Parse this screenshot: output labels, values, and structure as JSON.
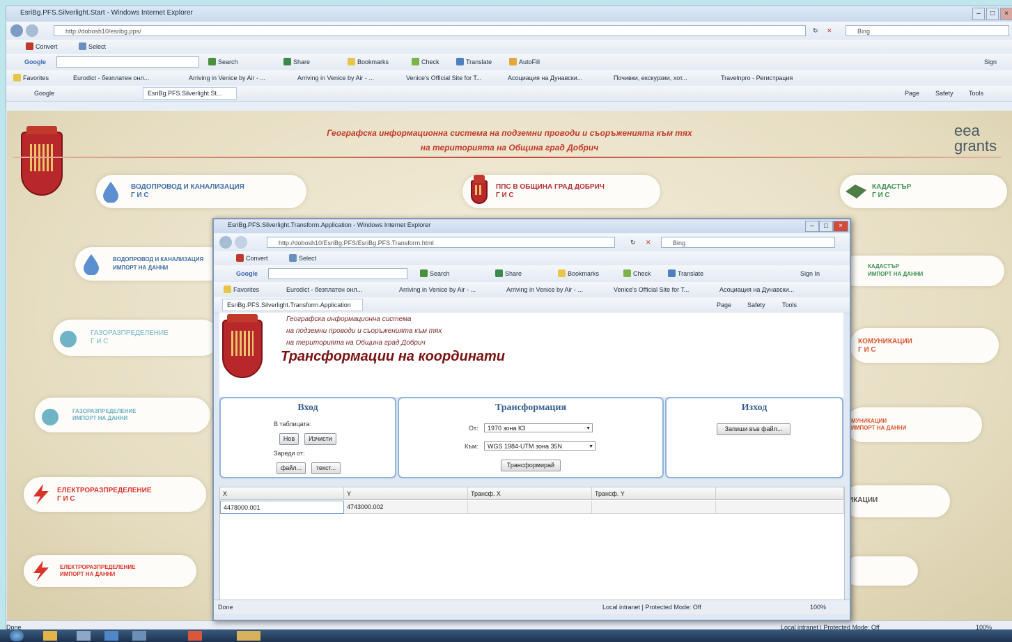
{
  "outer": {
    "title": "EsriBg.PFS.Silverlight.Start - Windows Internet Explorer",
    "address": "http://dobosh10/esribg.pps/",
    "search_engine": "Bing",
    "convert_label": "Convert",
    "select_label": "Select",
    "google_label": "Google",
    "toolbar": [
      "Search",
      "Share",
      "Bookmarks",
      "Check",
      "Translate",
      "AutoFill"
    ],
    "favorites_label": "Favorites",
    "favorites": [
      "Eurodict - безплатен онл...",
      "Arriving in Venice by Air - ...",
      "Arriving in Venice by Air - ...",
      "Venice's Official Site for T...",
      "Асоциация на Дунавски...",
      "Почивки, екскурзии, хот...",
      "Travelnpro - Регистрация"
    ],
    "tabs": [
      "Google",
      "EsriBg.PFS.Silverlight.St..."
    ],
    "cmd": [
      "Page",
      "Safety",
      "Tools"
    ],
    "signin": "Sign",
    "status": "Done",
    "status_zone": "Local intranet | Protected Mode: Off",
    "zoom": "100%"
  },
  "portal": {
    "header_line1": "Географска информационна система на подземни проводи и съоръженията към тях",
    "header_line2": "на територията на Община град Добрич",
    "logo_line1": "eea",
    "logo_line2": "grants",
    "tiles": [
      {
        "title": "ВОДОПРОВОД И КАНАЛИЗАЦИЯ",
        "sub": "Г И С",
        "color": "#3f6ea8"
      },
      {
        "title": "ППС В ОБЩИНА ГРАД ДОБРИЧ",
        "sub": "Г И С",
        "color": "#b0323a"
      },
      {
        "title": "КАДАСТЪР",
        "sub": "Г И С",
        "color": "#3d8f55"
      },
      {
        "title": "ВОДОПРОВОД И КАНАЛИЗАЦИЯ",
        "sub": "ИМПОРТ НА ДАННИ",
        "color": "#3f6ea8"
      },
      {
        "title": "КАДАСТЪР",
        "sub": "ИМПОРТ НА ДАННИ",
        "color": "#3d8f55"
      },
      {
        "title": "ГАЗОРАЗПРЕДЕЛЕНИЕ",
        "sub": "Г И С",
        "color": "#6fb3c6"
      },
      {
        "title": "КОМУНИКАЦИИ",
        "sub": "Г И С",
        "color": "#d9572f"
      },
      {
        "title": "ГАЗОРАЗПРЕДЕЛЕНИЕ",
        "sub": "ИМПОРТ НА ДАННИ",
        "color": "#6fb3c6"
      },
      {
        "title": "МУНИКАЦИИ",
        "sub": "ИМПОРТ НА ДАННИ",
        "color": "#d9572f"
      },
      {
        "title": "ЕЛЕКТРОРАЗПРЕДЕЛЕНИЕ",
        "sub": "Г И С",
        "color": "#d8342c"
      },
      {
        "title": "ИКАЦИИ",
        "sub": "",
        "color": "#555555"
      },
      {
        "title": "ЕЛЕКТРОРАЗПРЕДЕЛЕНИЕ",
        "sub": "ИМПОРТ НА ДАННИ",
        "color": "#d8342c"
      }
    ]
  },
  "inner": {
    "title": "EsriBg.PFS.Silverlight.Transform.Application - Windows Internet Explorer",
    "address": "http://dobosh10/EsriBg.PFS/EsriBg.PFS.Transform.html",
    "search_engine": "Bing",
    "tab": "EsriBg.PFS.Silverlight.Transform.Application",
    "signin": "Sign In",
    "status": "Done",
    "status_zone": "Local intranet | Protected Mode: Off",
    "zoom": "100%",
    "header_line1": "Географска информационна система",
    "header_line2": "на подземни проводи и съоръженията към тях",
    "header_line3": "на територията на Община град Добрич",
    "app_title": "Трансформации на координати"
  },
  "app": {
    "input_title": "Вход",
    "in_table_label": "В таблицата:",
    "new_button": "Нов",
    "clear_button": "Изчисти",
    "load_from_label": "Зареди от:",
    "file_button": "файл...",
    "text_button": "текст...",
    "transform_title": "Трансформация",
    "from_label": "От:",
    "from_value": "1970 зона К3",
    "to_label": "Към:",
    "to_value": "WGS 1984-UTM зона 35N",
    "transform_button": "Трансформирай",
    "output_title": "Изход",
    "write_button": "Запиши във файл...",
    "columns": [
      "X",
      "Y",
      "Трансф. X",
      "Трансф. Y"
    ],
    "rows": [
      [
        "4478000.001",
        "4743000.002",
        "",
        ""
      ]
    ]
  },
  "colors": {
    "header_red": "#c0392b",
    "panel_border": "#8fb3d9",
    "app_title": "#7a1212"
  }
}
